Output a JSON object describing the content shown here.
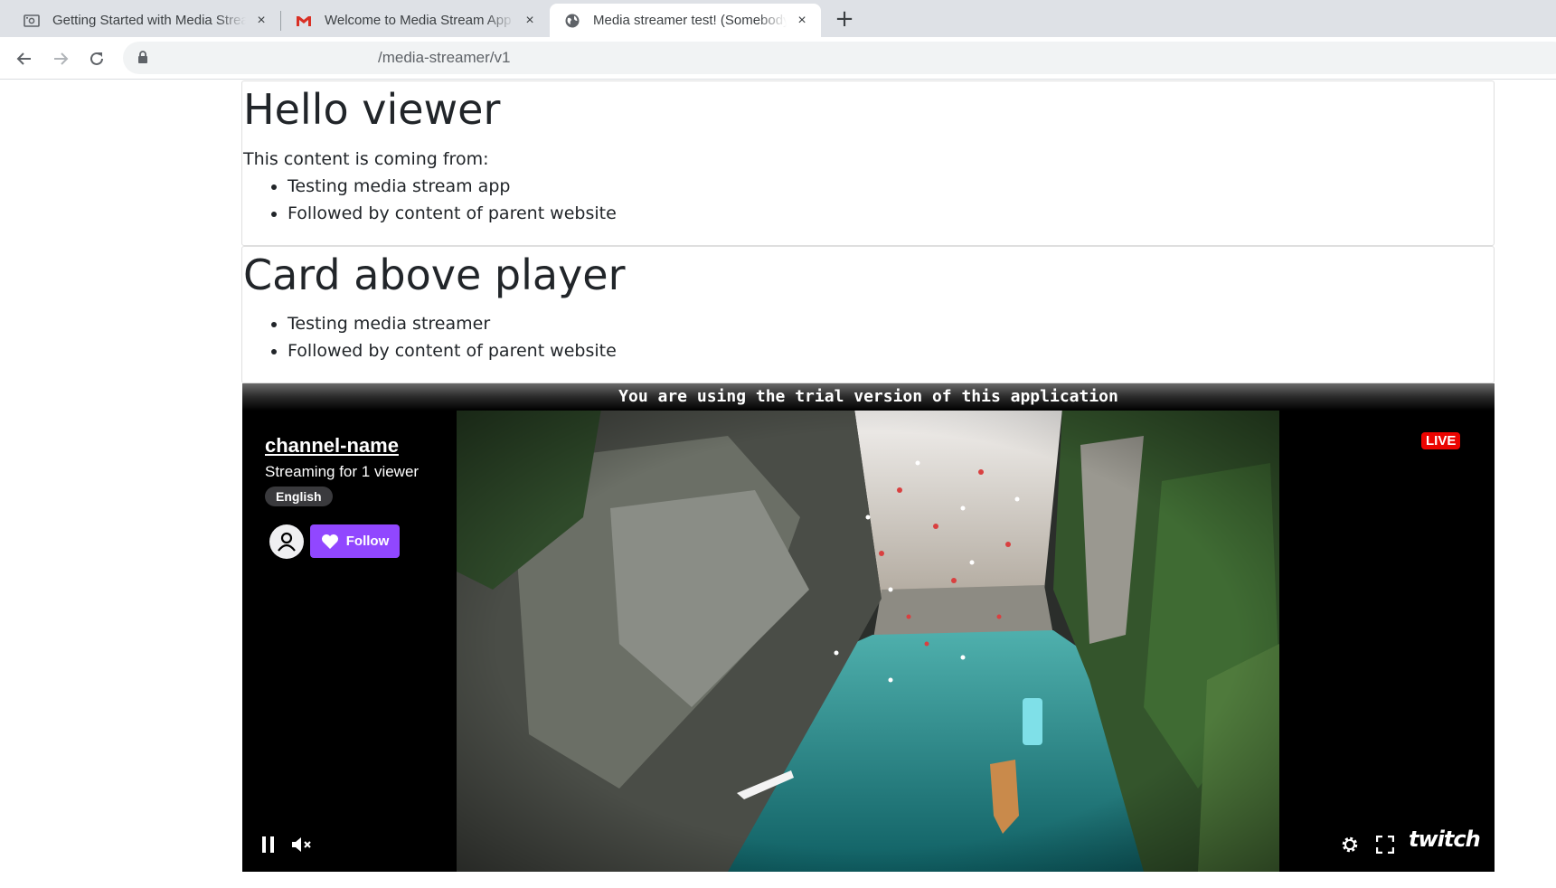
{
  "browser": {
    "tabs": [
      {
        "title": "Getting Started with Media Streamer",
        "icon": "media-icon",
        "close": "×"
      },
      {
        "title": "Welcome to Media Stream App - ",
        "icon": "gmail-icon",
        "close": "×"
      },
      {
        "title": "Media streamer test! (Somebody",
        "icon": "globe-icon",
        "close": "×",
        "active": true
      }
    ],
    "new_tab": "+",
    "url": "/media-streamer/v1"
  },
  "card1": {
    "heading": "Hello viewer",
    "text": "This content is coming from:",
    "items": [
      "Testing media stream app",
      "Followed by content of parent website"
    ]
  },
  "card2": {
    "heading": "Card above player",
    "items": [
      "Testing media streamer",
      "Followed by content of parent website"
    ]
  },
  "player": {
    "trial_banner": "You are using the trial version of this application",
    "channel_name": "channel-name",
    "status": "Streaming for 1 viewer",
    "language": "English",
    "follow_label": "Follow",
    "live_badge": "LIVE",
    "brand": "twitch",
    "colors": {
      "follow": "#9147ff",
      "live": "#eb0400"
    }
  }
}
